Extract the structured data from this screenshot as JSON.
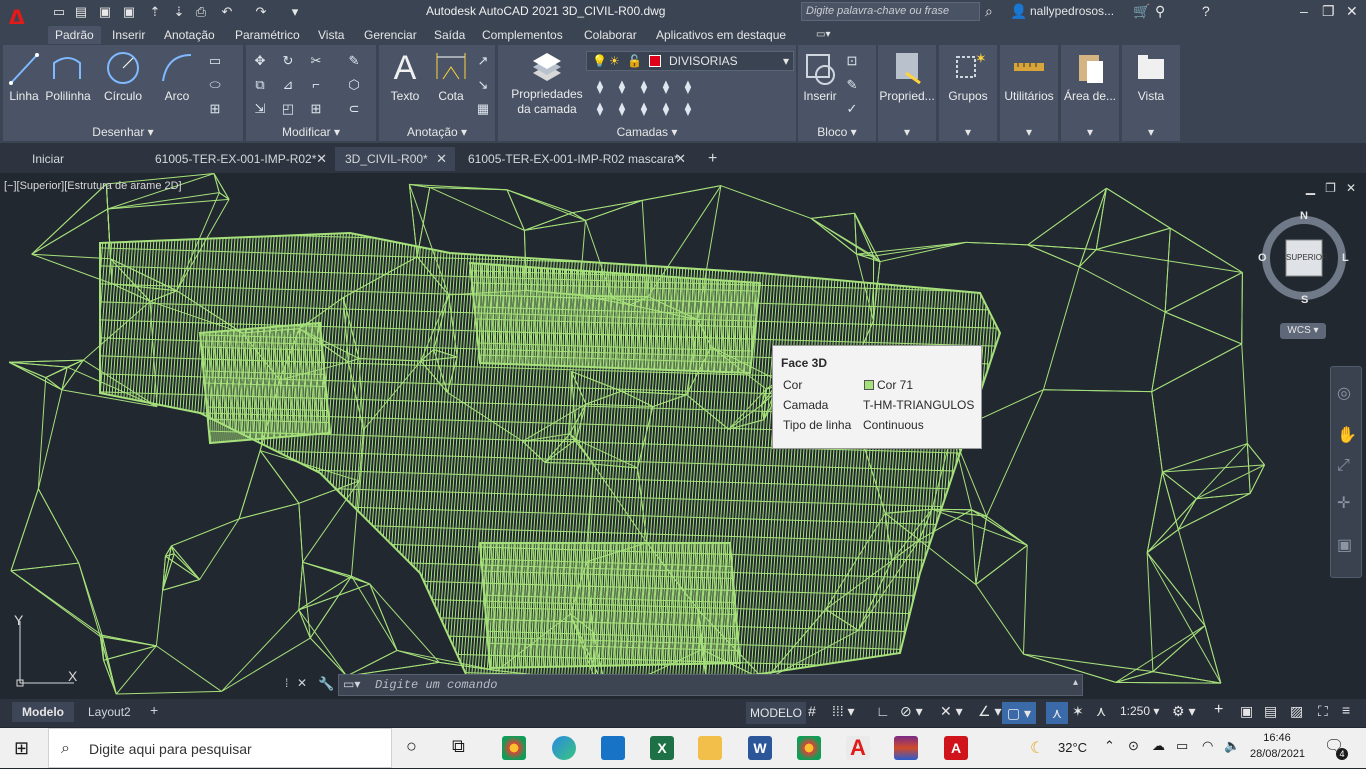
{
  "app": {
    "title": "Autodesk AutoCAD 2021    3D_CIVIL-R00.dwg",
    "logo": "A",
    "search_placeholder": "Digite palavra-chave ou frase",
    "user": "nallypedrosos..."
  },
  "ribbon_tabs": [
    "Padrão",
    "Inserir",
    "Anotação",
    "Paramétrico",
    "Vista",
    "Gerenciar",
    "Saída",
    "Complementos",
    "Colaborar",
    "Aplicativos em destaque"
  ],
  "ribbon": {
    "draw": {
      "title": "Desenhar",
      "buttons": [
        "Linha",
        "Polilinha",
        "Círculo",
        "Arco"
      ]
    },
    "modify": {
      "title": "Modificar"
    },
    "annotation": {
      "title": "Anotação",
      "buttons": [
        "Texto",
        "Cota"
      ]
    },
    "layers": {
      "title": "Camadas",
      "props_line1": "Propriedades",
      "props_line2": "da camada",
      "current_layer": "DIVISORIAS",
      "layer_color": "#e1001a"
    },
    "block": {
      "title": "Bloco",
      "button": "Inserir"
    },
    "extra": [
      "Propried...",
      "Grupos",
      "Utilitários",
      "Área de...",
      "Vista"
    ]
  },
  "file_tabs": [
    {
      "label": "Iniciar",
      "closable": false
    },
    {
      "label": "61005-TER-EX-001-IMP-R02*",
      "closable": true
    },
    {
      "label": "3D_CIVIL-R00*",
      "closable": true,
      "active": true
    },
    {
      "label": "61005-TER-EX-001-IMP-R02 mascara*",
      "closable": true
    }
  ],
  "viewport": {
    "label": "[−][Superior][Estrutura de arame 2D]",
    "compass": {
      "n": "N",
      "s": "S",
      "e": "L",
      "w": "O",
      "center": "SUPERIOR",
      "ucs": "WCS"
    },
    "wire_color": "#a6e07a"
  },
  "tooltip": {
    "title": "Face 3D",
    "rows": [
      {
        "key": "Cor",
        "value": "Cor 71",
        "swatch": "#a6e07a"
      },
      {
        "key": "Camada",
        "value": "T-HM-TRIANGULOS"
      },
      {
        "key": "Tipo de linha",
        "value": "Continuous"
      }
    ]
  },
  "command_line": {
    "placeholder": "Digite um comando"
  },
  "layout_tabs": [
    "Modelo",
    "Layout2"
  ],
  "status_bar": {
    "mode": "MODELO",
    "scale": "1:250"
  },
  "taskbar": {
    "search_placeholder": "Digite aqui para pesquisar",
    "temperature": "32°C",
    "time": "16:46",
    "date": "28/08/2021",
    "notifications": "4"
  }
}
